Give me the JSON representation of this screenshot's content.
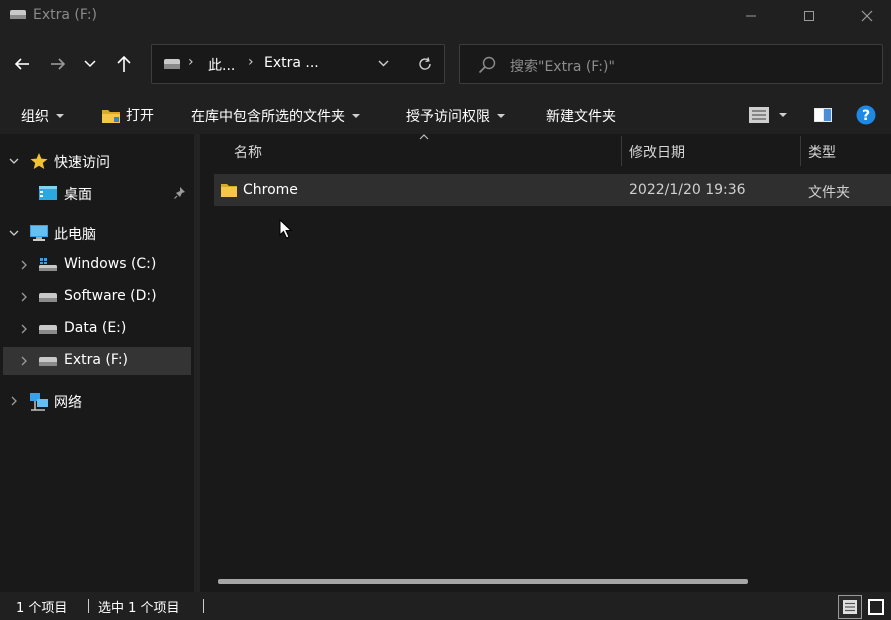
{
  "window": {
    "title": "Extra (F:)",
    "controls": [
      "minimize",
      "maximize",
      "close"
    ]
  },
  "navigation": {
    "breadcrumb": [
      "此...",
      "Extra ..."
    ],
    "search_placeholder": "搜索\"Extra (F:)\""
  },
  "commands": {
    "organize": "组织",
    "open": "打开",
    "include_in_library": "在库中包含所选的文件夹",
    "grant_access": "授予访问权限",
    "new_folder": "新建文件夹"
  },
  "sidebar": {
    "quick_access": "快速访问",
    "desktop": "桌面",
    "this_pc": "此电脑",
    "drives": [
      {
        "label": "Windows (C:)"
      },
      {
        "label": "Software (D:)"
      },
      {
        "label": "Data (E:)"
      },
      {
        "label": "Extra (F:)",
        "selected": true
      }
    ],
    "network": "网络"
  },
  "list": {
    "columns": [
      "名称",
      "修改日期",
      "类型"
    ],
    "rows": [
      {
        "name": "Chrome",
        "modified": "2022/1/20 19:36",
        "type": "文件夹",
        "selected": true
      }
    ]
  },
  "status": {
    "item_count": "1 个项目",
    "selected_count": "选中 1 个项目"
  },
  "colors": {
    "background": "#191919",
    "chrome": "#202020",
    "selection": "#343434",
    "folder": "#f4c74b",
    "help": "#1e88e5",
    "star": "#f2c232"
  }
}
